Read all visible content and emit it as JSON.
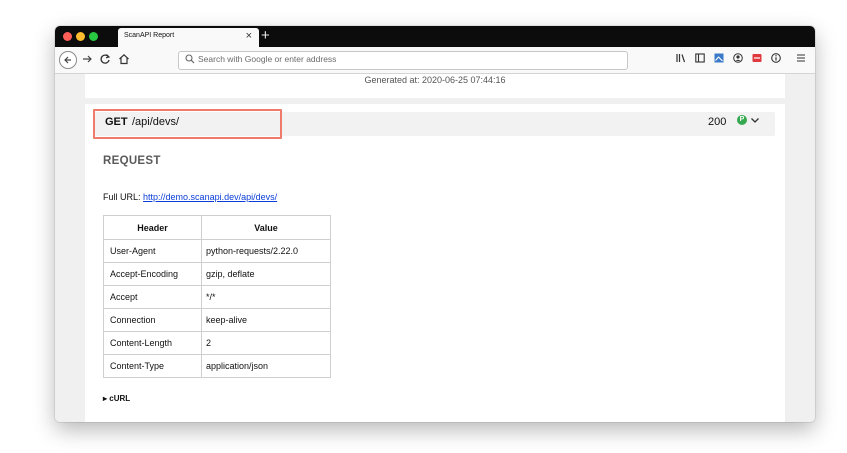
{
  "browser": {
    "tab": {
      "title": "ScanAPI Report",
      "close_glyph": "×"
    },
    "new_tab_glyph": "+",
    "address_bar": {
      "placeholder": "Search with Google or enter address"
    },
    "nav_icons": [
      "back-icon",
      "forward-icon",
      "reload-icon",
      "home-icon"
    ],
    "toolbar_icons": [
      "library-icon",
      "sidebar-icon",
      "screenshot-icon",
      "account-icon",
      "extension-icon",
      "info-icon",
      "menu-icon"
    ],
    "traffic_light_colors": [
      "#ff5f57",
      "#febc2e",
      "#28c840"
    ]
  },
  "report": {
    "generated": "Generated at: 2020-06-25 07:44:16",
    "endpoint": {
      "method": "GET",
      "path": "/api/devs/",
      "status_code": "200",
      "status_badge": "P",
      "status_badge_color": "#36a84f"
    },
    "request": {
      "heading": "REQUEST",
      "full_url_label": "Full URL:",
      "full_url": "http://demo.scanapi.dev/api/devs/",
      "table": {
        "columns": [
          "Header",
          "Value"
        ],
        "rows": [
          [
            "User-Agent",
            "python-requests/2.22.0"
          ],
          [
            "Accept-Encoding",
            "gzip, deflate"
          ],
          [
            "Accept",
            "*/*"
          ],
          [
            "Connection",
            "keep-alive"
          ],
          [
            "Content-Length",
            "2"
          ],
          [
            "Content-Type",
            "application/json"
          ]
        ]
      },
      "curl_label": "cURL",
      "curl_marker": "▸"
    },
    "highlight_color": "#ee7b6b"
  }
}
